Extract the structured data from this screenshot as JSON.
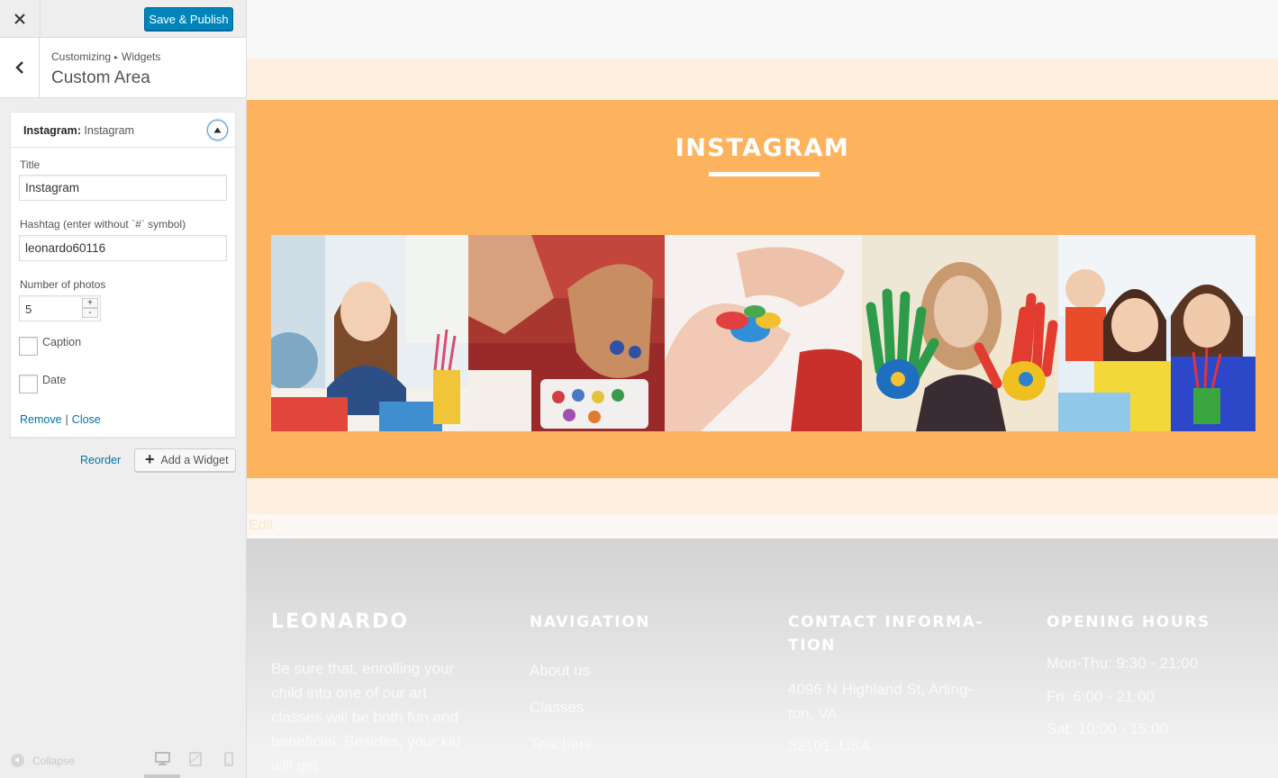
{
  "header": {
    "close_icon": "close-icon",
    "publish_label": "Save & Publish"
  },
  "section": {
    "crumb_root": "Customizing",
    "crumb_sep": "▸",
    "crumb_leaf": "Widgets",
    "title": "Custom Area"
  },
  "widget": {
    "type": "Instagram:",
    "name": "Instagram",
    "title_label": "Title",
    "title_value": "Instagram",
    "hashtag_label": "Hashtag (enter without `#` symbol)",
    "hashtag_value": "leonardo60116",
    "count_label": "Number of photos",
    "count_value": "5",
    "caption_label": "Caption",
    "date_label": "Date",
    "remove_label": "Remove",
    "sep": "|",
    "close_label": "Close"
  },
  "actions": {
    "reorder_label": "Reorder",
    "add_label": "Add a Widget"
  },
  "footer_bar": {
    "collapse_label": "Collapse",
    "devices": [
      "desktop-icon",
      "tablet-icon",
      "mobile-icon"
    ]
  },
  "preview": {
    "instagram_title": "INSTAGRAM",
    "edit_label": "Edit",
    "photos": [
      "girl-at-desk-photo",
      "child-painting-clay-photo",
      "hands-with-plasticine-photo",
      "painted-hands-photo",
      "kids-smiling-photo"
    ],
    "footer": {
      "brand": "LEONARDO",
      "about": "Be sure that, enrolling your child into one of our art classes will be both fun and beneficial. Besides, your kid will get",
      "nav_heading": "NAVIGATION",
      "nav_items": [
        "About us",
        "Classes",
        "Teachers"
      ],
      "contact_heading": "CONTACT INFORMA-TION",
      "contact_lines": [
        "4096 N Highland St, Arling-",
        "ton, VA",
        "32101, USA"
      ],
      "hours_heading": "OPENING HOURS",
      "hours": [
        "Mon-Thu: 9:30 - 21:00",
        "Fri: 6:00 - 21:00",
        "Sat: 10:00 - 15:00"
      ]
    }
  },
  "colors": {
    "accent": "#0085ba",
    "instagram_band": "#fdb35d",
    "cream_band": "#fdefe0",
    "link": "#0073aa"
  }
}
